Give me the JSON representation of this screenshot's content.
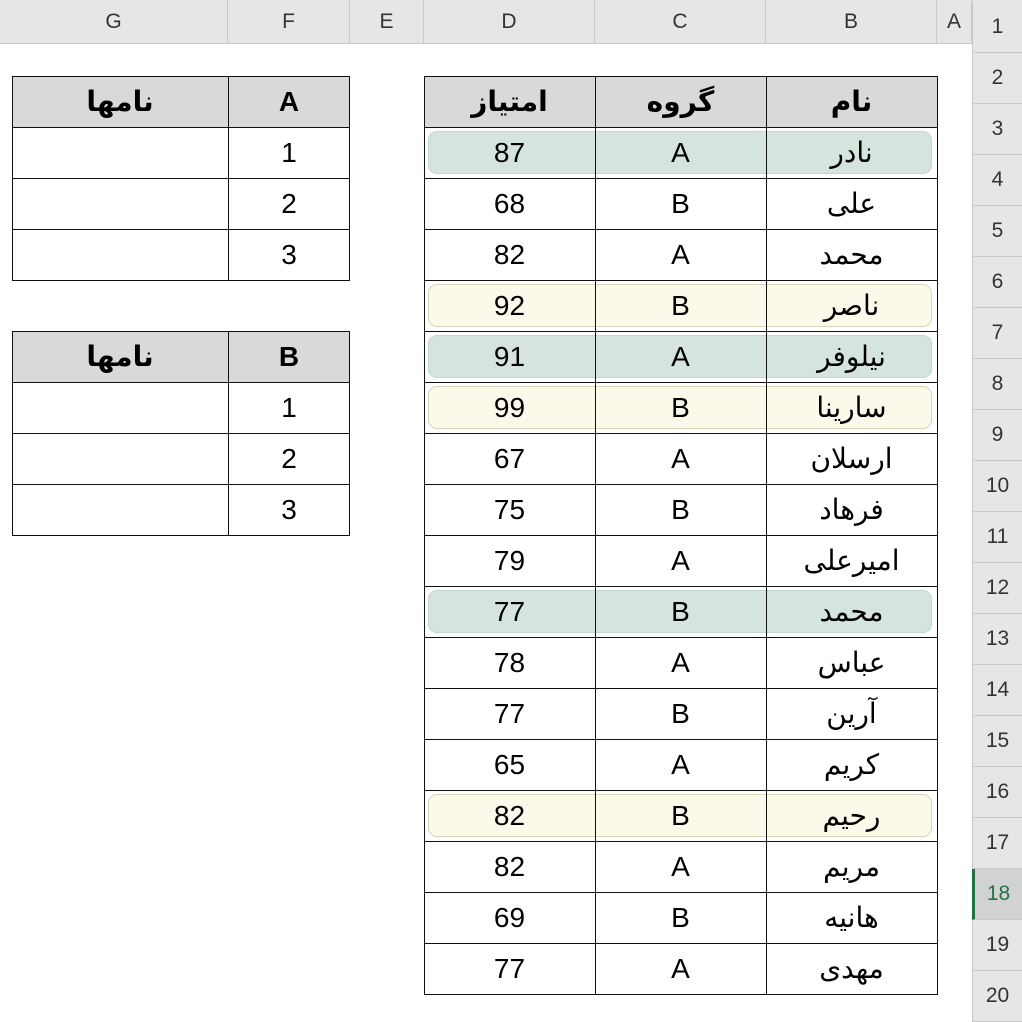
{
  "columns": [
    "A",
    "B",
    "C",
    "D",
    "E",
    "F",
    "G"
  ],
  "rows": [
    "1",
    "2",
    "3",
    "4",
    "5",
    "6",
    "7",
    "8",
    "9",
    "10",
    "11",
    "12",
    "13",
    "14",
    "15",
    "16",
    "17",
    "18",
    "19",
    "20"
  ],
  "selected_row": "18",
  "main_table": {
    "headers": [
      "نام",
      "گروه",
      "امتیاز"
    ],
    "rows": [
      {
        "name": "نادر",
        "group": "A",
        "score": "87",
        "highlight": "green"
      },
      {
        "name": "علی",
        "group": "B",
        "score": "68",
        "highlight": ""
      },
      {
        "name": "محمد",
        "group": "A",
        "score": "82",
        "highlight": ""
      },
      {
        "name": "ناصر",
        "group": "B",
        "score": "92",
        "highlight": "yellow"
      },
      {
        "name": "نیلوفر",
        "group": "A",
        "score": "91",
        "highlight": "green"
      },
      {
        "name": "سارینا",
        "group": "B",
        "score": "99",
        "highlight": "yellow"
      },
      {
        "name": "ارسلان",
        "group": "A",
        "score": "67",
        "highlight": ""
      },
      {
        "name": "فرهاد",
        "group": "B",
        "score": "75",
        "highlight": ""
      },
      {
        "name": "امیرعلی",
        "group": "A",
        "score": "79",
        "highlight": ""
      },
      {
        "name": "محمد",
        "group": "B",
        "score": "77",
        "highlight": "green"
      },
      {
        "name": "عباس",
        "group": "A",
        "score": "78",
        "highlight": ""
      },
      {
        "name": "آرین",
        "group": "B",
        "score": "77",
        "highlight": ""
      },
      {
        "name": "کریم",
        "group": "A",
        "score": "65",
        "highlight": ""
      },
      {
        "name": "رحیم",
        "group": "B",
        "score": "82",
        "highlight": "yellow"
      },
      {
        "name": "مریم",
        "group": "A",
        "score": "82",
        "highlight": ""
      },
      {
        "name": "هانیه",
        "group": "B",
        "score": "69",
        "highlight": ""
      },
      {
        "name": "مهدی",
        "group": "A",
        "score": "77",
        "highlight": ""
      }
    ]
  },
  "group_tables": [
    {
      "group": "A",
      "names_header": "نامها",
      "ranks": [
        "1",
        "2",
        "3"
      ],
      "names": [
        "",
        "",
        ""
      ]
    },
    {
      "group": "B",
      "names_header": "نامها",
      "ranks": [
        "1",
        "2",
        "3"
      ],
      "names": [
        "",
        "",
        ""
      ]
    }
  ],
  "colors": {
    "accent": "#217346",
    "header_fill": "#d9d9d9",
    "highlight_green": "#d5e4dc",
    "highlight_yellow": "#fbf9ea"
  }
}
